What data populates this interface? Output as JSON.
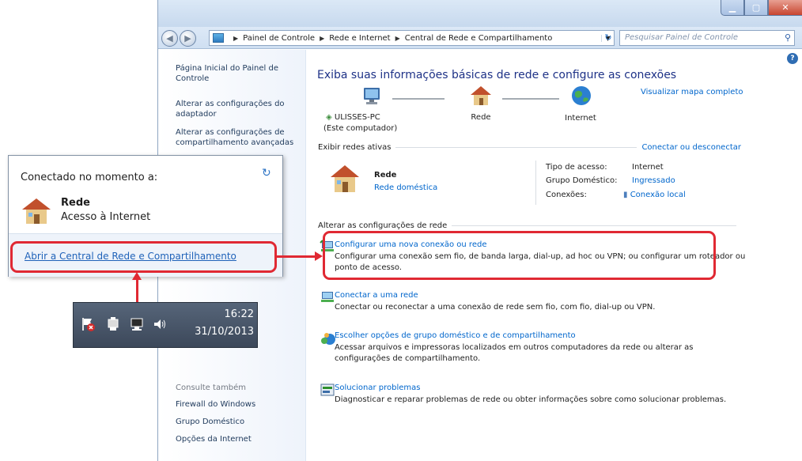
{
  "window": {
    "breadcrumb": [
      "Painel de Controle",
      "Rede e Internet",
      "Central de Rede e Compartilhamento"
    ],
    "search_placeholder": "Pesquisar Painel de Controle"
  },
  "sidebar": {
    "items": [
      "Página Inicial do Painel de Controle",
      "Alterar as configurações do adaptador",
      "Alterar as configurações de compartilhamento avançadas"
    ],
    "see_also_title": "Consulte também",
    "see_also": [
      "Firewall do Windows",
      "Grupo Doméstico",
      "Opções da Internet"
    ]
  },
  "main": {
    "heading": "Exiba suas informações básicas de rede e configure as conexões",
    "map_link": "Visualizar mapa completo",
    "map_nodes": [
      {
        "label": "ULISSES-PC",
        "sub": "(Este computador)"
      },
      {
        "label": "Rede"
      },
      {
        "label": "Internet"
      }
    ],
    "active_title": "Exibir redes ativas",
    "active_link": "Conectar ou desconectar",
    "network": {
      "name": "Rede",
      "type_link": "Rede doméstica"
    },
    "details": {
      "labels": [
        "Tipo de acesso:",
        "Grupo Doméstico:",
        "Conexões:"
      ],
      "values": [
        "Internet",
        "Ingressado",
        "Conexão local"
      ]
    },
    "change_title": "Alterar as configurações de rede",
    "actions": [
      {
        "title": "Configurar uma nova conexão ou rede",
        "desc": "Configurar uma conexão sem fio, de banda larga, dial-up, ad hoc ou VPN; ou configurar um roteador ou ponto de acesso."
      },
      {
        "title": "Conectar a uma rede",
        "desc": "Conectar ou reconectar a uma conexão de rede sem fio, com fio, dial-up ou VPN."
      },
      {
        "title": "Escolher opções de grupo doméstico e de compartilhamento",
        "desc": "Acessar arquivos e impressoras localizados em outros computadores da rede ou alterar as configurações de compartilhamento."
      },
      {
        "title": "Solucionar problemas",
        "desc": "Diagnosticar e reparar problemas de rede ou obter informações sobre como solucionar problemas."
      }
    ]
  },
  "popup": {
    "title": "Conectado no momento a:",
    "network_name": "Rede",
    "network_status": "Acesso à Internet",
    "link": "Abrir a Central de Rede e Compartilhamento"
  },
  "taskbar": {
    "time": "16:22",
    "date": "31/10/2013"
  },
  "colors": {
    "highlight": "#e02933",
    "link": "#0066cc",
    "heading": "#1e3287"
  }
}
